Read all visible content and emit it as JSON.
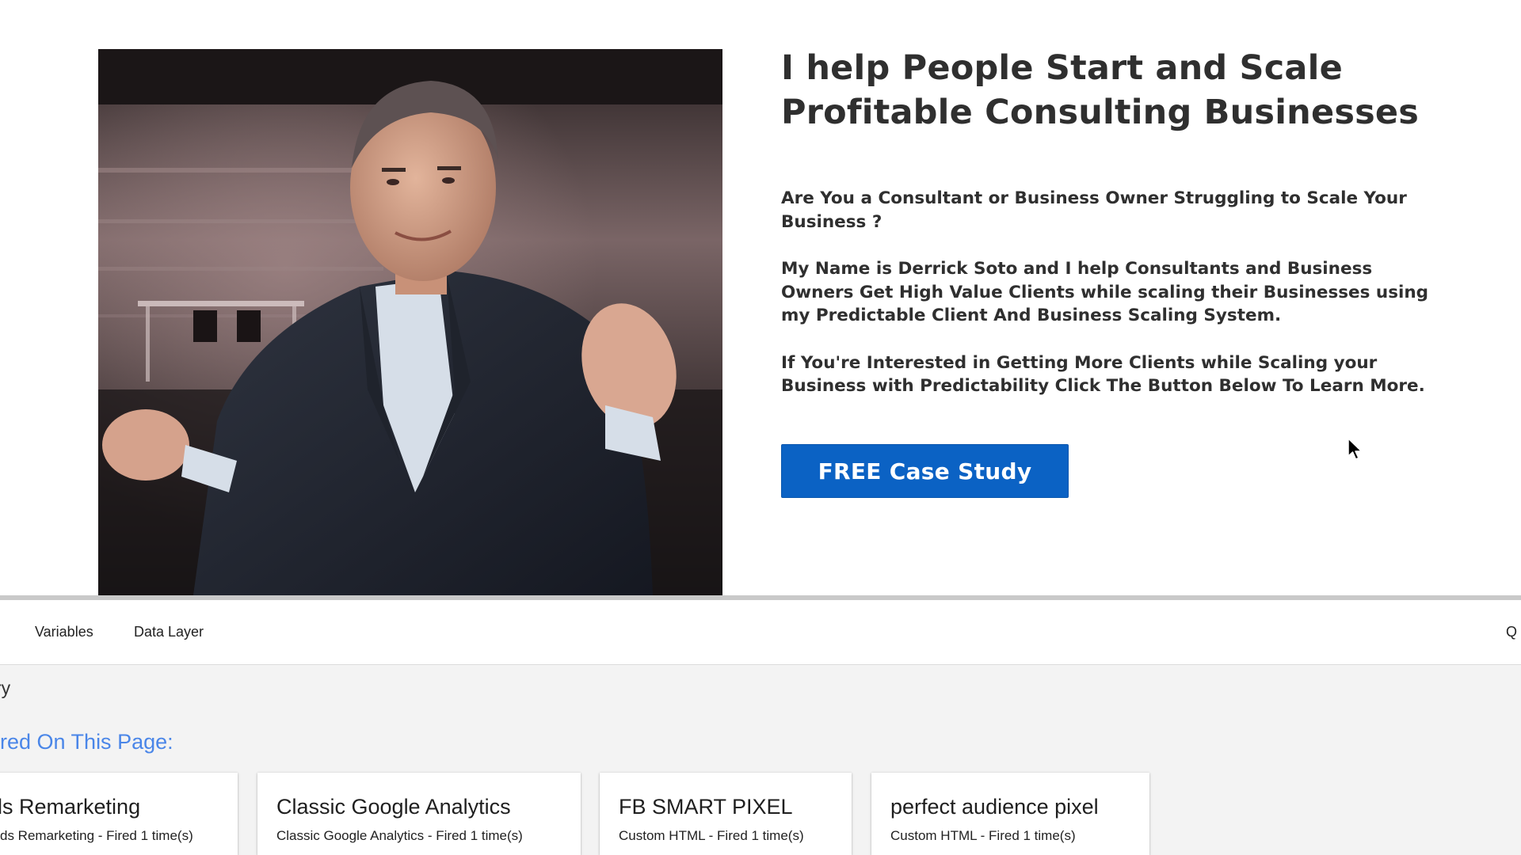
{
  "hero": {
    "headline": "I help People Start and Scale Profitable Consulting  Businesses",
    "paragraphs": {
      "question": "Are You a Consultant or Business Owner Struggling to Scale Your Business ?",
      "intro": "My Name is Derrick Soto and I help Consultants and Business Owners Get High Value Clients while scaling their Businesses using my Predictable Client And Business Scaling System.",
      "cta": "If You're Interested in Getting More Clients while Scaling your Business with Predictability Click The Button Below To Learn More."
    },
    "cta_button_label": "FREE Case Study",
    "photo_icon": "portrait-photo",
    "colors": {
      "cta_background": "#0b62c4",
      "headline_text": "#2f2f2f"
    }
  },
  "panel": {
    "tabs": {
      "variables": "Variables",
      "data_layer": "Data Layer",
      "clipped_right": "Q"
    },
    "heading": "ry",
    "fired_heading": "ired On This Page:",
    "tags": [
      {
        "name": "ords Remarketing",
        "status": "ds Remarketing - Fired 1 time(s)"
      },
      {
        "name": "Classic Google Analytics",
        "status": "Classic Google Analytics - Fired 1 time(s)"
      },
      {
        "name": "FB SMART PIXEL",
        "status": "Custom HTML - Fired 1 time(s)"
      },
      {
        "name": "perfect audience pixel",
        "status": "Custom HTML - Fired 1 time(s)"
      }
    ],
    "colors": {
      "fired_heading": "#4a86e8",
      "panel_background": "#f3f3f3"
    }
  },
  "cursor_icon": "mouse-pointer-icon"
}
